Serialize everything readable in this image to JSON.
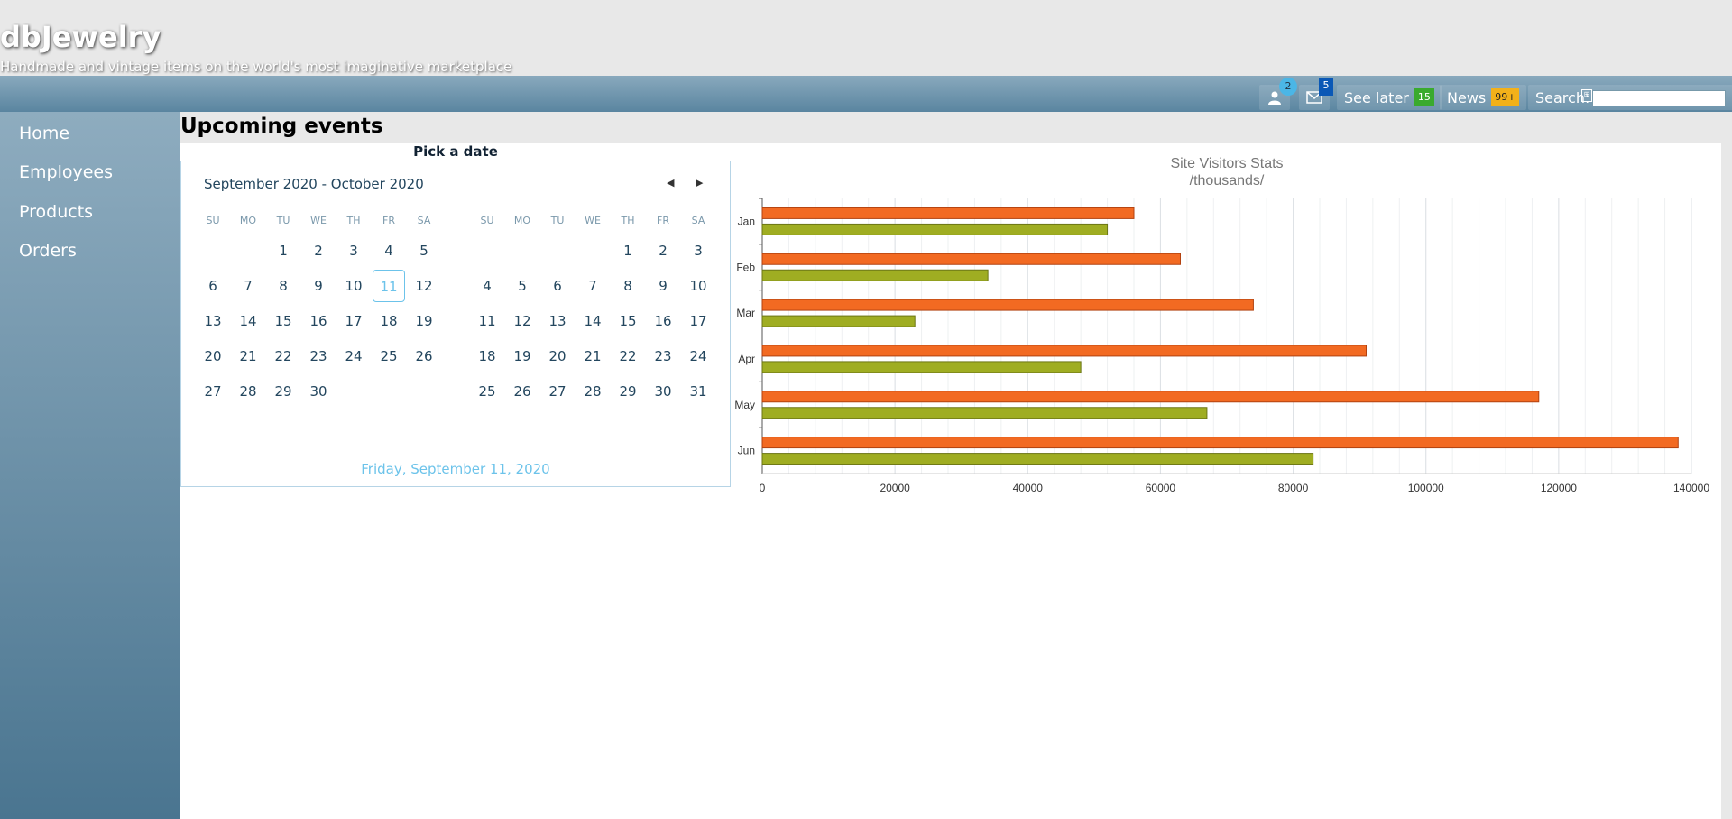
{
  "app": {
    "logo": "dbJewelry",
    "tagline": "Handmade and vintage items on the world's most imaginative marketplace"
  },
  "toolbar": {
    "user_badge": "2",
    "mail_badge": "5",
    "see_later_label": "See later",
    "see_later_count": "15",
    "see_later_color": "#3aaa2e",
    "news_label": "News",
    "news_count": "99+",
    "news_color": "#f2b11a",
    "search_label": "Search:",
    "search_value": ""
  },
  "sidebar": {
    "items": [
      {
        "label": "Home"
      },
      {
        "label": "Employees"
      },
      {
        "label": "Products"
      },
      {
        "label": "Orders"
      }
    ]
  },
  "main": {
    "title": "Upcoming events"
  },
  "calendar": {
    "heading": "Pick a date",
    "range_title": "September 2020 - October 2020",
    "weekdays": [
      "SU",
      "MO",
      "TU",
      "WE",
      "TH",
      "FR",
      "SA"
    ],
    "months": [
      {
        "name": "September 2020",
        "weeks": [
          [
            "",
            "",
            "1",
            "2",
            "3",
            "4",
            "5"
          ],
          [
            "6",
            "7",
            "8",
            "9",
            "10",
            "11",
            "12"
          ],
          [
            "13",
            "14",
            "15",
            "16",
            "17",
            "18",
            "19"
          ],
          [
            "20",
            "21",
            "22",
            "23",
            "24",
            "25",
            "26"
          ],
          [
            "27",
            "28",
            "29",
            "30",
            "",
            "",
            ""
          ]
        ]
      },
      {
        "name": "October 2020",
        "weeks": [
          [
            "",
            "",
            "",
            "",
            "1",
            "2",
            "3"
          ],
          [
            "4",
            "5",
            "6",
            "7",
            "8",
            "9",
            "10"
          ],
          [
            "11",
            "12",
            "13",
            "14",
            "15",
            "16",
            "17"
          ],
          [
            "18",
            "19",
            "20",
            "21",
            "22",
            "23",
            "24"
          ],
          [
            "25",
            "26",
            "27",
            "28",
            "29",
            "30",
            "31"
          ]
        ]
      }
    ],
    "selected_day": "11",
    "selected_label": "Friday, September 11, 2020"
  },
  "chart_data": {
    "type": "bar",
    "orientation": "horizontal",
    "title": "Site Visitors Stats",
    "subtitle": "/thousands/",
    "categories": [
      "Jan",
      "Feb",
      "Mar",
      "Apr",
      "May",
      "Jun"
    ],
    "series": [
      {
        "values": [
          56000,
          63000,
          74000,
          91000,
          117000,
          138000
        ],
        "color": "#f26a22"
      },
      {
        "values": [
          52000,
          34000,
          23000,
          48000,
          67000,
          83000
        ],
        "color": "#9fad22"
      }
    ],
    "xlim": [
      0,
      140000
    ],
    "xticks": [
      0,
      20000,
      40000,
      60000,
      80000,
      100000,
      120000,
      140000
    ],
    "grid": true,
    "legend": false
  }
}
